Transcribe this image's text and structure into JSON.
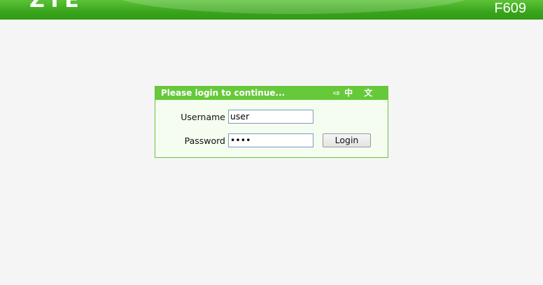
{
  "header": {
    "logo_text": "ZTE",
    "model": "F609",
    "brand_color": "#3aa51c"
  },
  "login": {
    "title": "Please login to continue...",
    "lang_icon": "arrow-right-icon",
    "lang_label": "中 文",
    "username_label": "Username",
    "username_value": "user",
    "password_label": "Password",
    "password_value": "••••",
    "login_button": "Login",
    "accent_color": "#66c93a"
  }
}
